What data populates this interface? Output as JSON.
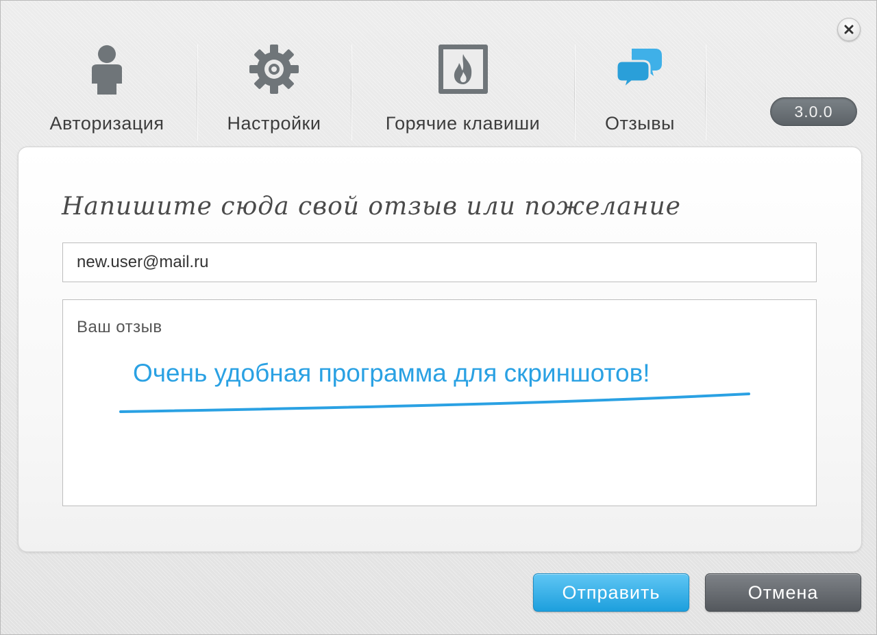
{
  "window": {
    "version": "3.0.0",
    "close_icon": "close-icon"
  },
  "tabs": [
    {
      "label": "Авторизация",
      "icon": "user-icon"
    },
    {
      "label": "Настройки",
      "icon": "gear-icon"
    },
    {
      "label": "Горячие клавиши",
      "icon": "flame-icon"
    },
    {
      "label": "Отзывы",
      "icon": "chat-bubbles-icon"
    }
  ],
  "form": {
    "heading": "Напишите сюда свой отзыв или пожелание",
    "email_value": "new.user@mail.ru",
    "review_placeholder": "Ваш отзыв",
    "annotation": "Очень удобная программа для скриншотов!"
  },
  "buttons": {
    "send": "Отправить",
    "cancel": "Отмена"
  },
  "colors": {
    "accent": "#1d9fdd",
    "annotation": "#2aa1e3",
    "cancel": "#5b6166"
  }
}
